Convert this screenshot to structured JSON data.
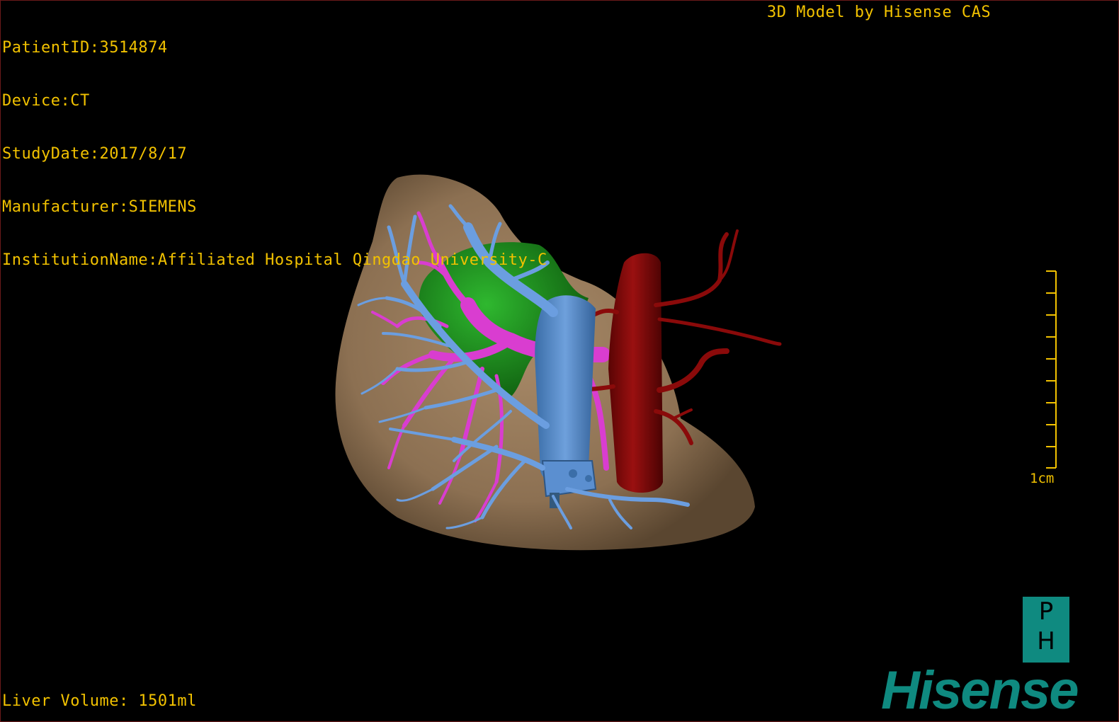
{
  "header": {
    "patient_id": "PatientID:3514874",
    "device": "Device:CT",
    "study_date": "StudyDate:2017/8/17",
    "manufacturer": "Manufacturer:SIEMENS",
    "institution": "InstitutionName:Affiliated Hospital Qingdao University-C"
  },
  "credit": "3D Model by Hisense CAS",
  "footer": {
    "liver_volume": "Liver Volume: 1501ml"
  },
  "scale": {
    "label": "1cm"
  },
  "logo": {
    "ph_top": "P",
    "ph_bottom": "H",
    "brand": "Hisense"
  },
  "colors": {
    "overlay_text": "#f2c200",
    "liver": "#9c8060",
    "hepatic_vein": "#5b8fd0",
    "portal_vein": "#d93dd0",
    "gallbladder": "#1e9a1e",
    "ivc_artery": "#8a0a0a",
    "brand": "#0f8a80"
  },
  "model_structures": [
    "liver",
    "hepatic-vein",
    "portal-vein",
    "gallbladder",
    "artery"
  ]
}
